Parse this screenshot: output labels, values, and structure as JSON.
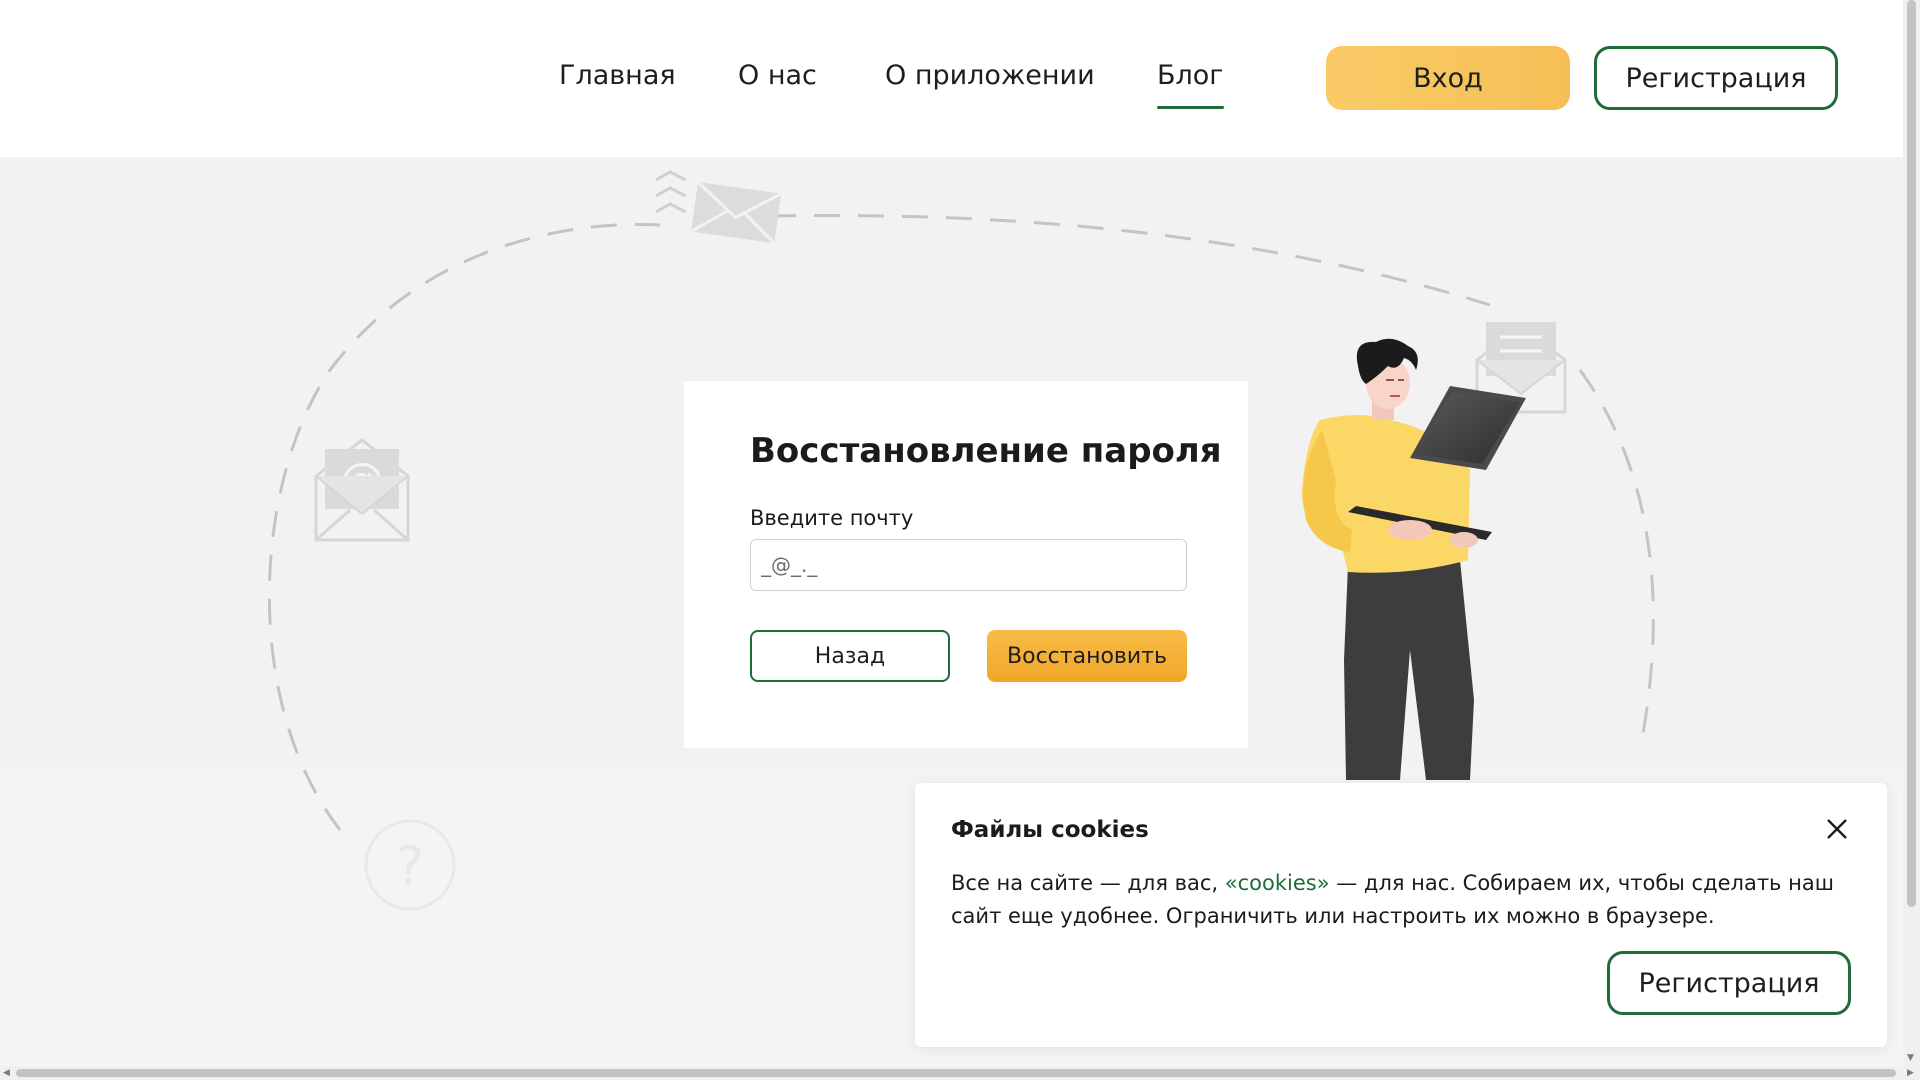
{
  "nav": {
    "items": [
      {
        "label": "Главная"
      },
      {
        "label": "О нас"
      },
      {
        "label": "О приложении"
      },
      {
        "label": "Блог"
      }
    ],
    "active": "Блог",
    "login_label": "Вход",
    "register_label": "Регистрация"
  },
  "recovery": {
    "title": "Восстановление пароля",
    "email_label": "Введите почту",
    "email_placeholder": "_@_._",
    "email_value": "",
    "back_label": "Назад",
    "restore_label": "Восстановить"
  },
  "cookie": {
    "title": "Файлы cookies",
    "text_before": "Все на сайте — для вас, ",
    "link": "«cookies»",
    "text_after": " — для нас. Собираем их, чтобы сделать наш сайт еще удобнее. Ограничить или настроить их можно в браузере.",
    "register_label": "Регистрация",
    "close_icon": "close-icon"
  },
  "decor": {
    "at_symbol": "@",
    "question_symbol": "?"
  },
  "colors": {
    "accent_green": "#1f6b3a",
    "accent_yellow": "#f6bf55",
    "restore_orange": "#f2a629",
    "sweater": "#fbd766",
    "pants": "#3d3d3d",
    "page_gray": "#f2f2f2"
  }
}
